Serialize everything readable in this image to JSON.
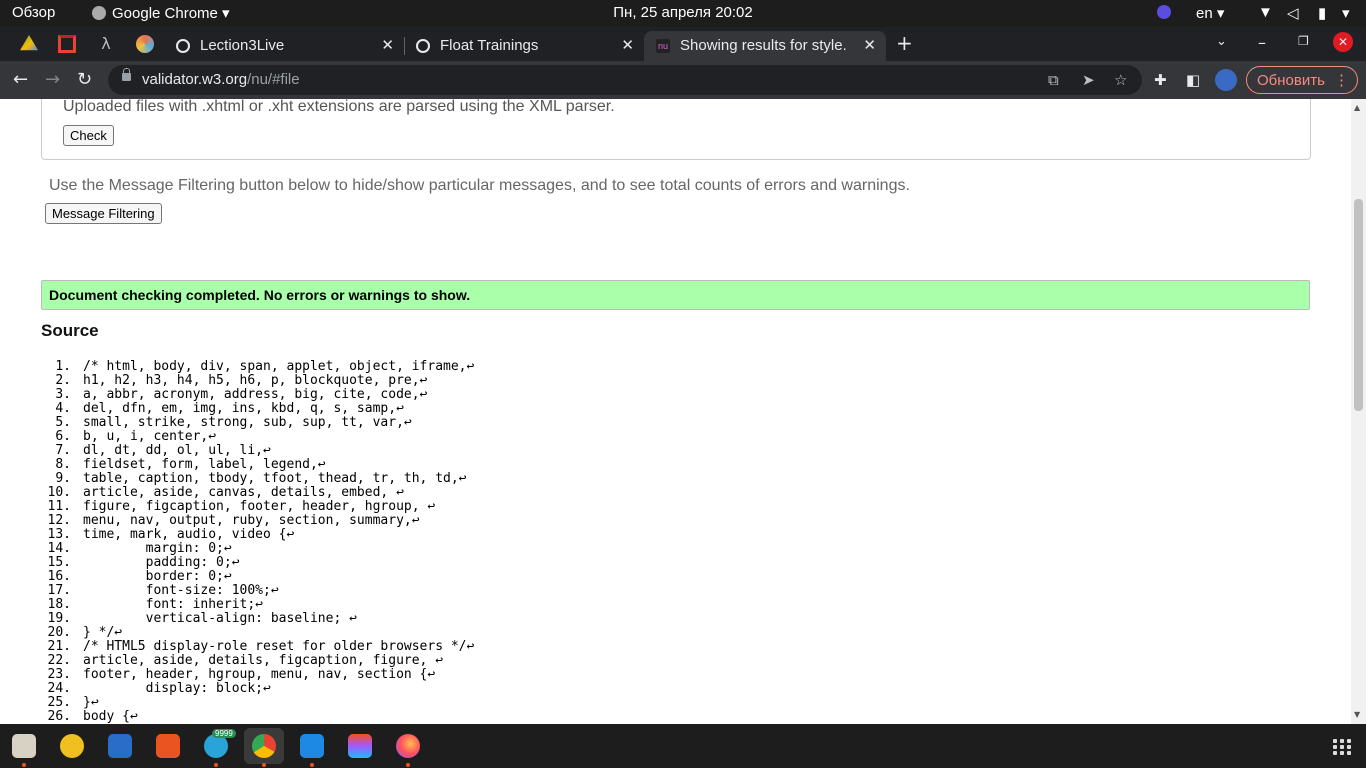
{
  "system_bar": {
    "overview": "Обзор",
    "active_app": "Google Chrome",
    "datetime": "Пн, 25 апреля  20:02",
    "lang": "en"
  },
  "tabs": [
    {
      "title": "Lection3Live",
      "close": "✕"
    },
    {
      "title": "Float Trainings",
      "close": "✕"
    },
    {
      "title": "Showing results for style.",
      "close": "✕"
    }
  ],
  "new_tab": "+",
  "toolbar": {
    "url_host": "validator.w3.org",
    "url_rest": "/nu/#file",
    "update_label": "Обновить"
  },
  "page": {
    "upload_note": "Uploaded files with .xhtml or .xht extensions are parsed using the XML parser.",
    "check_button": "Check",
    "filter_note": "Use the Message Filtering button below to hide/show particular messages, and to see total counts of errors and warnings.",
    "filter_button": "Message Filtering",
    "success_message": "Document checking completed. No errors or warnings to show.",
    "source_heading": "Source",
    "source_lines": [
      {
        "n": "1.",
        "text": "/* html, body, div, span, applet, object, iframe,↩"
      },
      {
        "n": "2.",
        "text": "h1, h2, h3, h4, h5, h6, p, blockquote, pre,↩"
      },
      {
        "n": "3.",
        "text": "a, abbr, acronym, address, big, cite, code,↩"
      },
      {
        "n": "4.",
        "text": "del, dfn, em, img, ins, kbd, q, s, samp,↩"
      },
      {
        "n": "5.",
        "text": "small, strike, strong, sub, sup, tt, var,↩"
      },
      {
        "n": "6.",
        "text": "b, u, i, center,↩"
      },
      {
        "n": "7.",
        "text": "dl, dt, dd, ol, ul, li,↩"
      },
      {
        "n": "8.",
        "text": "fieldset, form, label, legend,↩"
      },
      {
        "n": "9.",
        "text": "table, caption, tbody, tfoot, thead, tr, th, td,↩"
      },
      {
        "n": "10.",
        "text": "article, aside, canvas, details, embed, ↩"
      },
      {
        "n": "11.",
        "text": "figure, figcaption, footer, header, hgroup, ↩"
      },
      {
        "n": "12.",
        "text": "menu, nav, output, ruby, section, summary,↩"
      },
      {
        "n": "13.",
        "text": "time, mark, audio, video {↩"
      },
      {
        "n": "14.",
        "text": "        margin: 0;↩"
      },
      {
        "n": "15.",
        "text": "        padding: 0;↩"
      },
      {
        "n": "16.",
        "text": "        border: 0;↩"
      },
      {
        "n": "17.",
        "text": "        font-size: 100%;↩"
      },
      {
        "n": "18.",
        "text": "        font: inherit;↩"
      },
      {
        "n": "19.",
        "text": "        vertical-align: baseline; ↩"
      },
      {
        "n": "20.",
        "text": "} */↩"
      },
      {
        "n": "21.",
        "text": "/* HTML5 display-role reset for older browsers */↩"
      },
      {
        "n": "22.",
        "text": "article, aside, details, figcaption, figure, ↩"
      },
      {
        "n": "23.",
        "text": "footer, header, hgroup, menu, nav, section {↩"
      },
      {
        "n": "24.",
        "text": "        display: block;↩"
      },
      {
        "n": "25.",
        "text": "}↩"
      },
      {
        "n": "26.",
        "text": "body {↩"
      }
    ]
  },
  "taskbar": {
    "telegram_badge": "9999",
    "apps": [
      "files-icon",
      "rhythmbox-icon",
      "text-editor-icon",
      "software-center-icon",
      "telegram-icon",
      "chrome-icon",
      "vscode-icon",
      "figma-icon",
      "firefox-icon"
    ]
  },
  "colors": {
    "success_bg": "#aaffaa",
    "update_accent": "#f28b82",
    "taskbar_dot": "#e95420"
  }
}
